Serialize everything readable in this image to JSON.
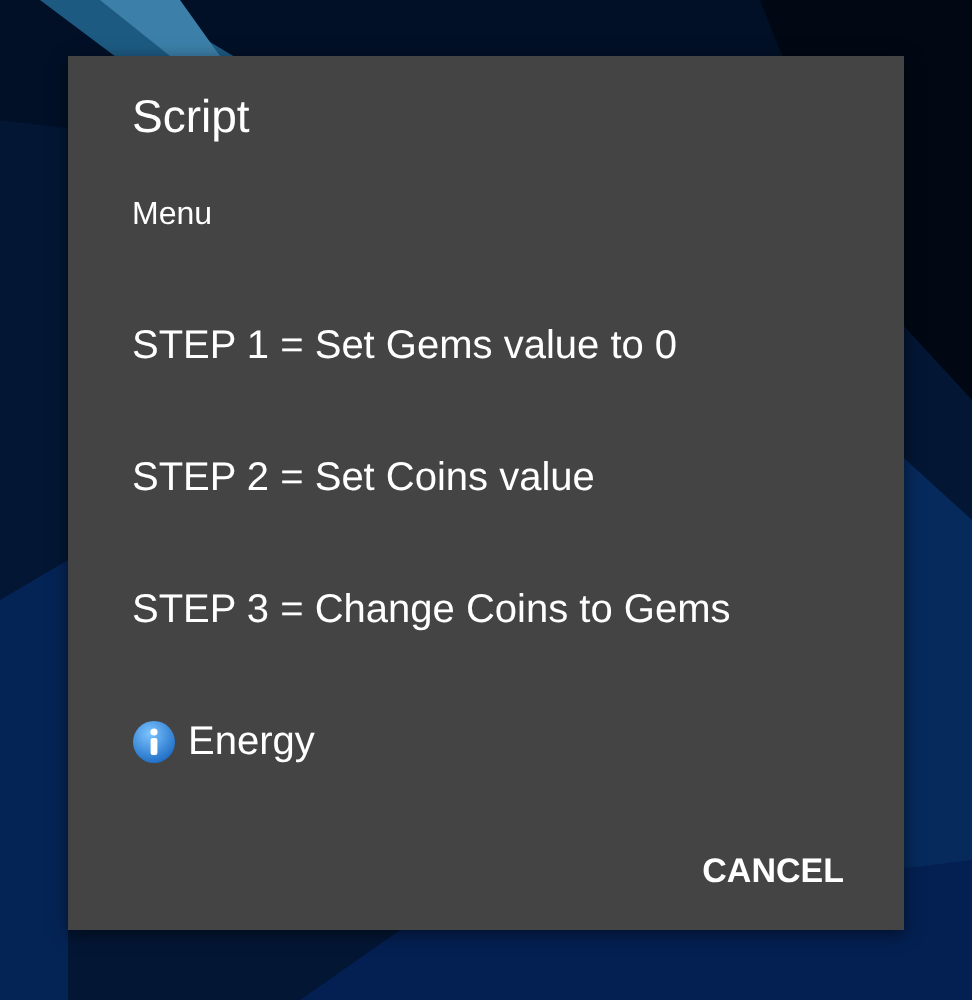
{
  "dialog": {
    "title": "Script",
    "subtitle": "Menu",
    "items": [
      {
        "kind": "text",
        "label": "STEP 1 = Set Gems value to 0"
      },
      {
        "kind": "text",
        "label": "STEP 2 = Set Coins value"
      },
      {
        "kind": "text",
        "label": "STEP 3 = Change Coins to Gems"
      },
      {
        "kind": "info",
        "label": "Energy"
      }
    ],
    "buttons": [
      "CANCEL"
    ]
  }
}
